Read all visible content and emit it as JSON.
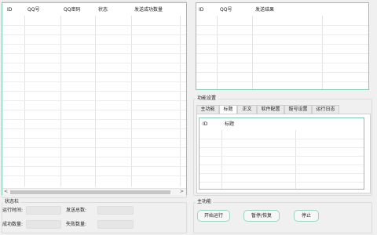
{
  "left_group": {
    "title": ""
  },
  "left_table": {
    "columns": [
      "ID",
      "QQ号",
      "QQ密码",
      "状态",
      "发送成功数量"
    ]
  },
  "right_table": {
    "columns": [
      "ID",
      "QQ号",
      "发送结果"
    ]
  },
  "feature_settings": {
    "title": "功能设置",
    "tabs": [
      "主功能",
      "标题",
      "正文",
      "软件配置",
      "拔号设置",
      "运行日志"
    ],
    "active_tab": "标题",
    "inner_columns": [
      "ID",
      "标题"
    ]
  },
  "status_bar": {
    "title": "状态栏",
    "run_time_label": "运行时间:",
    "run_time_value": "",
    "total_sent_label": "发送总数:",
    "total_sent_value": "",
    "success_label": "成功数量:",
    "success_value": "",
    "fail_label": "失败数量:",
    "fail_value": ""
  },
  "main_function": {
    "title": "主功能",
    "start_label": "开始运行",
    "pause_label": "暂停/恢复",
    "stop_label": "停止"
  },
  "scroll": {
    "left_arrow": "<",
    "right_arrow": ">"
  }
}
